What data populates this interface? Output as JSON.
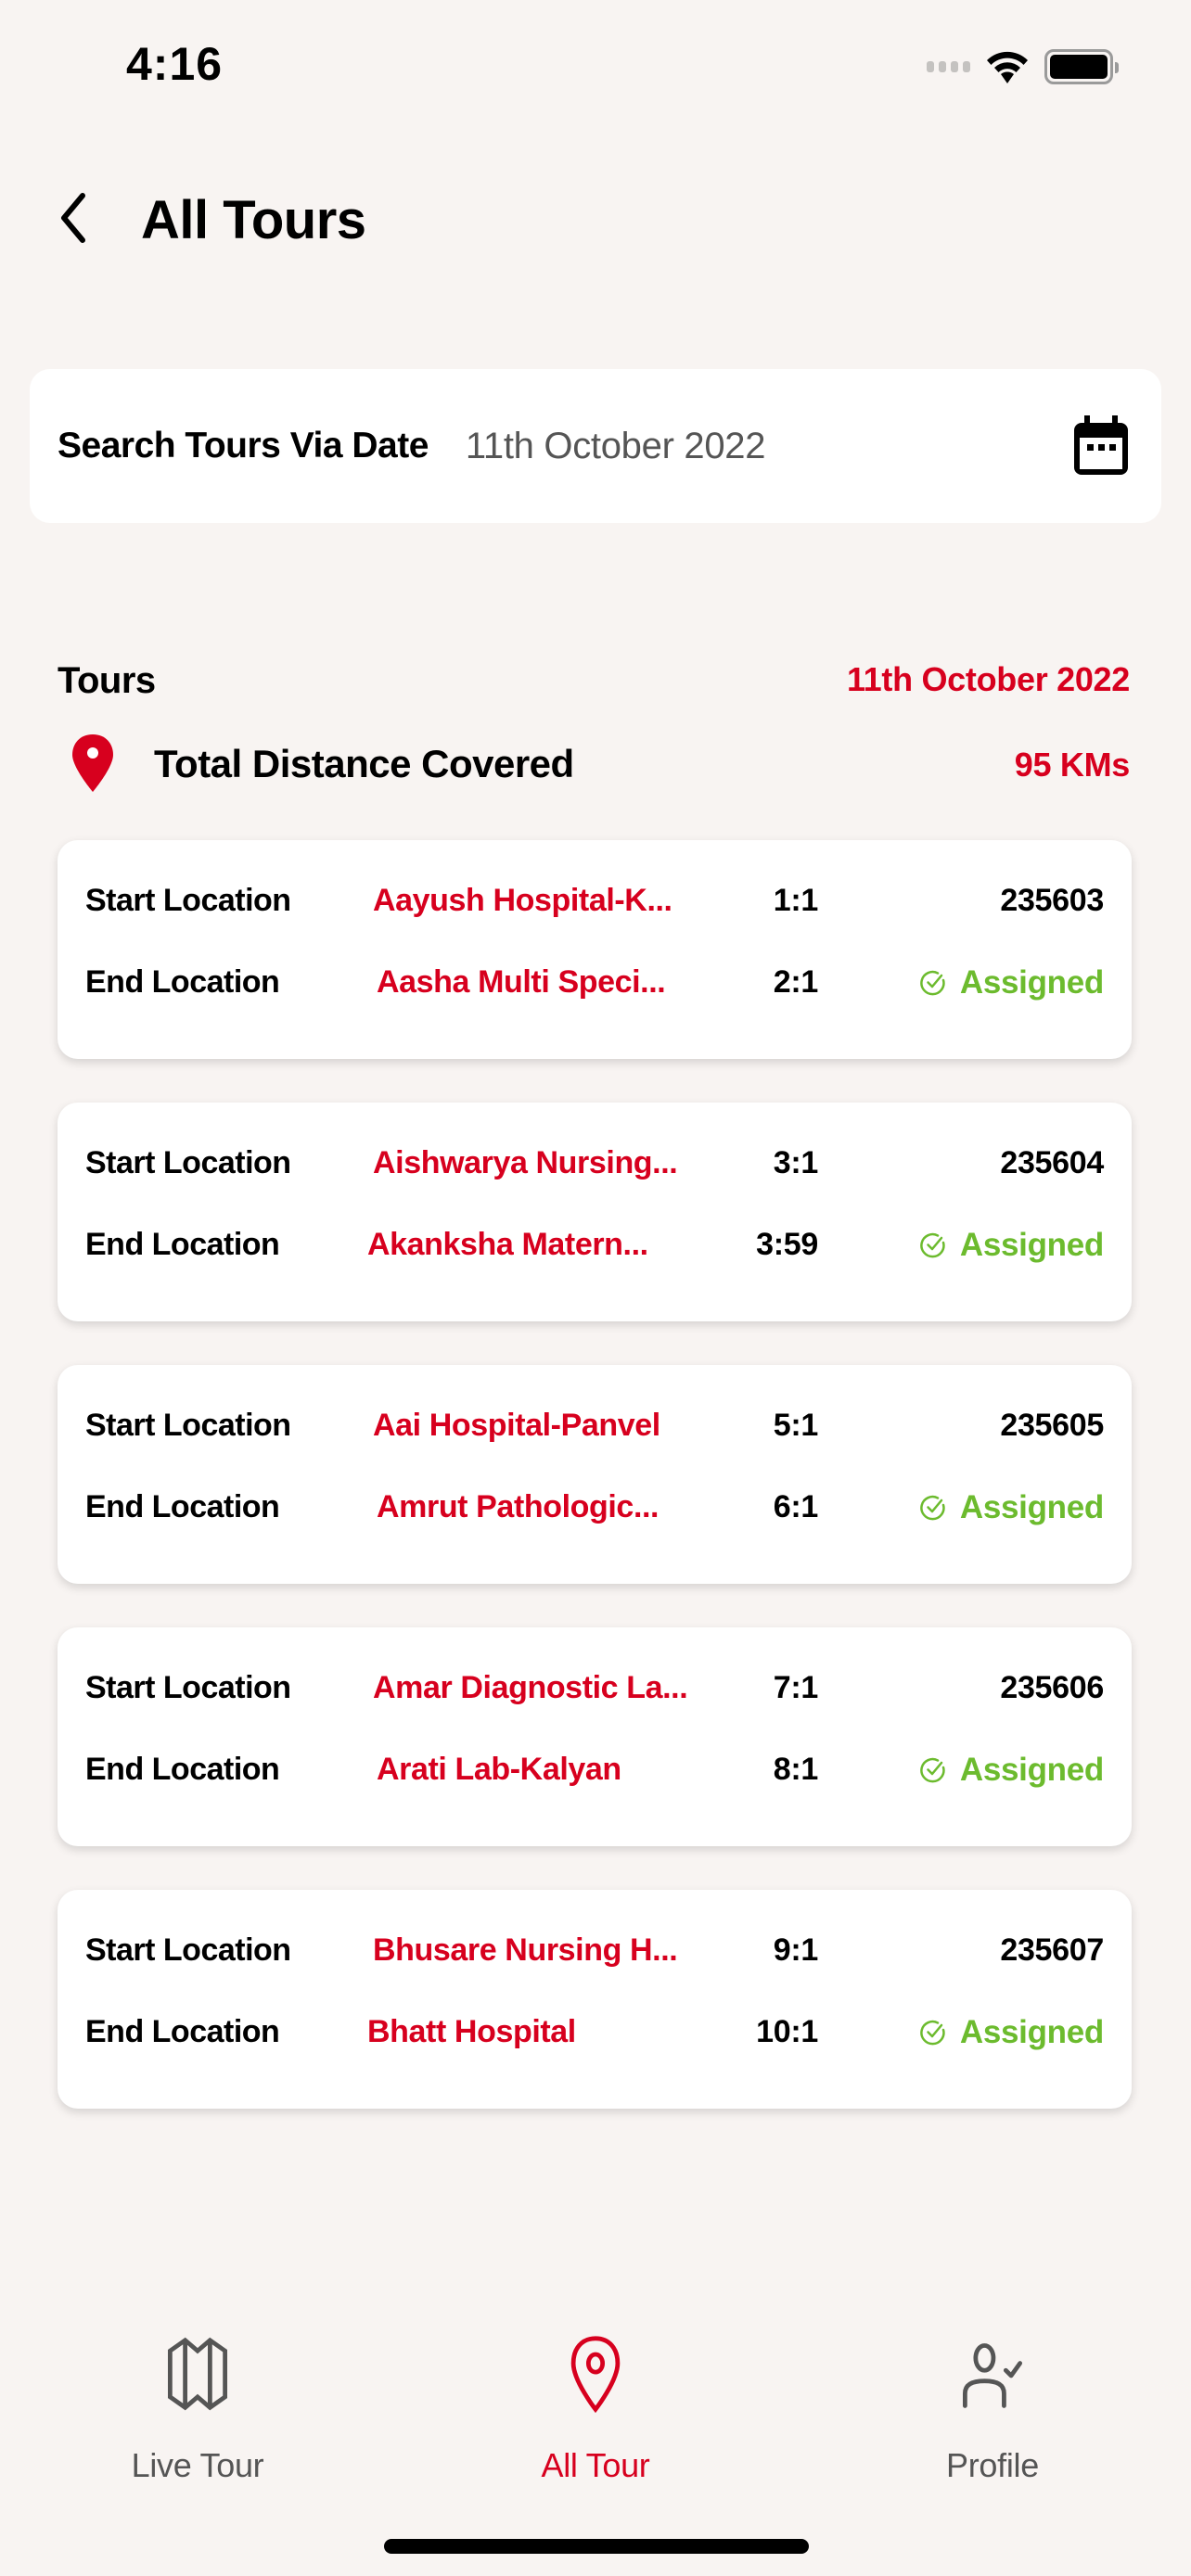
{
  "status_bar": {
    "time": "4:16",
    "icons": [
      "signal-icon",
      "wifi-icon",
      "battery-icon"
    ]
  },
  "header": {
    "back_icon": "chevron-left-icon",
    "title": "All Tours"
  },
  "search": {
    "label": "Search Tours Via Date",
    "value": "11th October 2022",
    "icon": "calendar-icon"
  },
  "tours": {
    "heading": "Tours",
    "date": "11th October 2022",
    "distance_icon": "map-pin-icon",
    "distance_label": "Total Distance Covered",
    "distance_value": "95 KMs",
    "start_label": "Start Location",
    "end_label": "End Location",
    "items": [
      {
        "start_location": "Aayush Hospital-K...",
        "start_time": "1:1",
        "end_location": "Aasha Multi Speci...",
        "end_time": "2:1",
        "id": "235603",
        "status": "Assigned"
      },
      {
        "start_location": "Aishwarya Nursing...",
        "start_time": "3:1",
        "end_location": "Akanksha Matern...",
        "end_time": "3:59",
        "id": "235604",
        "status": "Assigned"
      },
      {
        "start_location": "Aai Hospital-Panvel",
        "start_time": "5:1",
        "end_location": "Amrut Pathologic...",
        "end_time": "6:1",
        "id": "235605",
        "status": "Assigned"
      },
      {
        "start_location": "Amar Diagnostic La...",
        "start_time": "7:1",
        "end_location": "Arati Lab-Kalyan",
        "end_time": "8:1",
        "id": "235606",
        "status": "Assigned"
      },
      {
        "start_location": "Bhusare Nursing H...",
        "start_time": "9:1",
        "end_location": "Bhatt Hospital",
        "end_time": "10:1",
        "id": "235607",
        "status": "Assigned"
      }
    ]
  },
  "bottom_nav": {
    "items": [
      {
        "label": "Live Tour",
        "icon": "map-icon",
        "active": false
      },
      {
        "label": "All Tour",
        "icon": "location-pin-icon",
        "active": true
      },
      {
        "label": "Profile",
        "icon": "user-check-icon",
        "active": false
      }
    ]
  },
  "colors": {
    "background": "#f8f4f2",
    "accent_red": "#d7001e",
    "status_green": "#6cbb2e",
    "inactive_gray": "#555555"
  }
}
